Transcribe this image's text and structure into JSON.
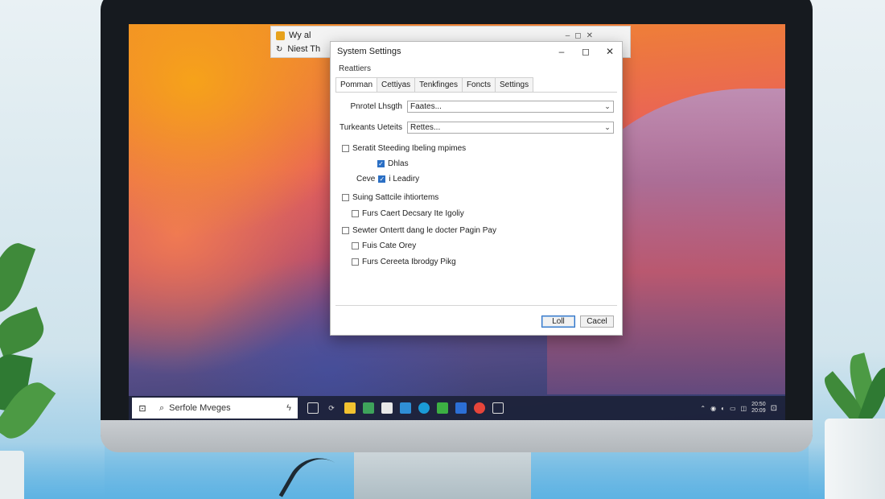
{
  "background_window": {
    "title": "Wy al",
    "line2": "Niest  Th"
  },
  "dialog": {
    "title": "System Settings",
    "section_label": "Reattiers",
    "tabs": [
      {
        "label": "Pomman"
      },
      {
        "label": "Cettiyas"
      },
      {
        "label": "Tenkfinges"
      },
      {
        "label": "Foncts"
      },
      {
        "label": "Settings"
      }
    ],
    "fields": [
      {
        "label": "Pnrotel Lhsgth",
        "value": "Faates..."
      },
      {
        "label": "Turkeants Ueteits",
        "value": "Rettes..."
      }
    ],
    "checks": [
      {
        "label": "Seratit Steeding Ibeling mpimes",
        "checked": false
      },
      {
        "label": "Dhlas",
        "checked": true
      },
      {
        "prefix": "Ceve",
        "label": "i Leadiry",
        "checked": true
      },
      {
        "label": "Suing Sattcile ihtiortems",
        "checked": false
      },
      {
        "label": "Furs Caert Decsary Ite Igoliy",
        "checked": false
      },
      {
        "label": "Sewter Ontertt dang le docter Pagin Pay",
        "checked": false
      },
      {
        "label": "Fuis Cate Orey",
        "checked": false
      },
      {
        "label": "Furs Cereeta Ibrodgy Pikg",
        "checked": false
      }
    ],
    "buttons": {
      "ok": "Loll",
      "cancel": "Cacel"
    }
  },
  "taskbar": {
    "search_text": "Serfole Mveges",
    "clock_line1": "20:50",
    "clock_line2": "20:09"
  },
  "colors": {
    "accent": "#2b6fc4",
    "taskbar": "#1c2238"
  }
}
